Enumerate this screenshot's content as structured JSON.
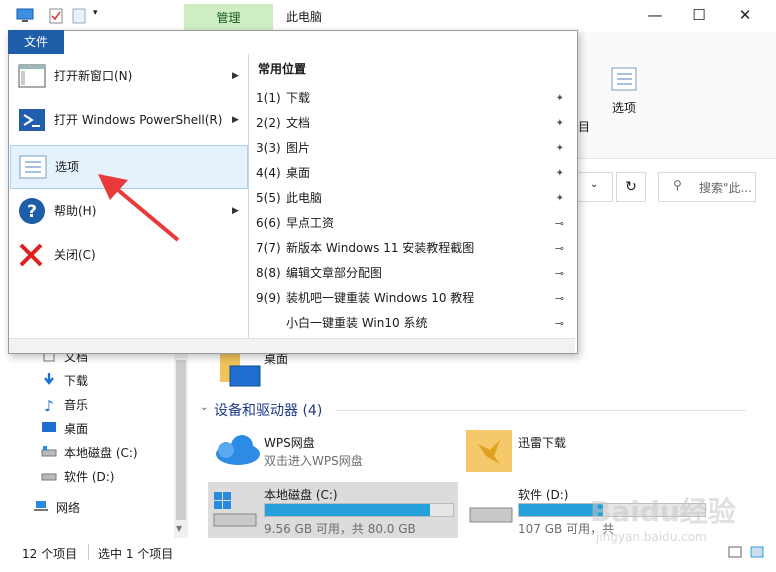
{
  "titlebar": {
    "manage_tab": "管理",
    "window_title": "此电脑",
    "minimize": "—",
    "maximize": "☐",
    "close": "✕",
    "help": "?"
  },
  "ribbon": {
    "options_label": "选项",
    "partial_label": "目"
  },
  "search": {
    "placeholder": "搜索\"此..."
  },
  "file_menu": {
    "tab_label": "文件",
    "items": [
      {
        "label": "打开新窗口(N)",
        "icon": "window-icon",
        "has_submenu": true
      },
      {
        "label": "打开 Windows PowerShell(R)",
        "icon": "powershell-icon",
        "has_submenu": true
      },
      {
        "label": "选项",
        "icon": "options-icon",
        "has_submenu": false,
        "selected": true
      },
      {
        "label": "帮助(H)",
        "icon": "help-icon",
        "has_submenu": true
      },
      {
        "label": "关闭(C)",
        "icon": "close-x-icon",
        "has_submenu": false
      }
    ],
    "recent_header": "常用位置",
    "recent": [
      {
        "num": "1(1)",
        "label": "下载",
        "pinned": true
      },
      {
        "num": "2(2)",
        "label": "文档",
        "pinned": true
      },
      {
        "num": "3(3)",
        "label": "图片",
        "pinned": true
      },
      {
        "num": "4(4)",
        "label": "桌面",
        "pinned": true
      },
      {
        "num": "5(5)",
        "label": "此电脑",
        "pinned": true
      },
      {
        "num": "6(6)",
        "label": "早点工资",
        "pinned": false
      },
      {
        "num": "7(7)",
        "label": "新版本 Windows 11 安装教程截图",
        "pinned": false
      },
      {
        "num": "8(8)",
        "label": "编辑文章部分配图",
        "pinned": false
      },
      {
        "num": "9(9)",
        "label": "装机吧一键重装 Windows 10 教程",
        "pinned": false
      },
      {
        "num": "",
        "label": "小白一键重装 Win10 系统",
        "pinned": false
      }
    ]
  },
  "nav": {
    "items": [
      {
        "label": "文档",
        "icon": "documents-icon"
      },
      {
        "label": "下载",
        "icon": "download-icon"
      },
      {
        "label": "音乐",
        "icon": "music-icon"
      },
      {
        "label": "桌面",
        "icon": "desktop-icon"
      },
      {
        "label": "本地磁盘 (C:)",
        "icon": "drive-icon"
      },
      {
        "label": "软件 (D:)",
        "icon": "drive-icon"
      },
      {
        "label": "网络",
        "icon": "network-icon"
      }
    ]
  },
  "content": {
    "desktop_folder": "桌面",
    "section_title": "设备和驱动器 (4)",
    "devices": [
      {
        "name": "WPS网盘",
        "sub": "双击进入WPS网盘"
      },
      {
        "name": "迅雷下载",
        "sub": ""
      }
    ],
    "drives": [
      {
        "name": "本地磁盘 (C:)",
        "sub": "9.56 GB 可用，共 80.0 GB",
        "used_fraction": 0.88
      },
      {
        "name": "软件 (D:)",
        "sub": "107 GB 可用，共",
        "used_fraction": 0.45
      }
    ]
  },
  "status": {
    "count": "12 个项目",
    "selected": "选中 1 个项目"
  },
  "watermark": {
    "brand": "Baidu经验",
    "url": "jingyan.baidu.com"
  },
  "colors": {
    "accent": "#1e5da8",
    "manage_tab": "#cdeec3",
    "bar_fill": "#26a0da",
    "arrow": "#e83a3a"
  }
}
